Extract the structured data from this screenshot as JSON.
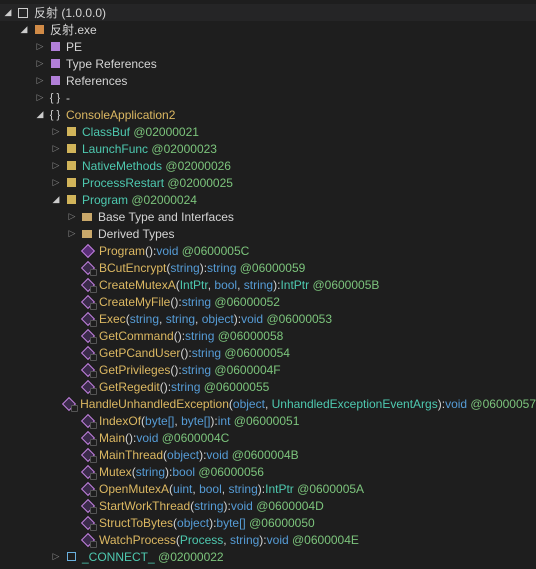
{
  "tab": {
    "title": "反射 (1.0.0.0)"
  },
  "root": {
    "name": "反射.exe"
  },
  "sections": [
    {
      "label": "PE"
    },
    {
      "label": "Type References"
    },
    {
      "label": "References"
    },
    {
      "label": "-"
    }
  ],
  "namespace": "ConsoleApplication2",
  "classes": [
    {
      "name": "ClassBuf",
      "token": "@02000021"
    },
    {
      "name": "LaunchFunc",
      "token": "@02000023"
    },
    {
      "name": "NativeMethods",
      "token": "@02000026"
    },
    {
      "name": "ProcessRestart",
      "token": "@02000025"
    }
  ],
  "program": {
    "name": "Program",
    "token": "@02000024"
  },
  "folders": [
    {
      "label": "Base Type and Interfaces"
    },
    {
      "label": "Derived Types"
    }
  ],
  "methods": [
    {
      "name": "Program",
      "params": [],
      "ret": "void",
      "token": "@0600005C",
      "kind": "pub"
    },
    {
      "name": "BCutEncrypt",
      "params": [
        "string"
      ],
      "ret": "string",
      "token": "@06000059",
      "kind": "stat"
    },
    {
      "name": "CreateMutexA",
      "params": [
        "IntPtr",
        "bool",
        "string"
      ],
      "ret": "IntPtr",
      "token": "@0600005B",
      "kind": "stat"
    },
    {
      "name": "CreateMyFile",
      "params": [],
      "ret": "string",
      "token": "@06000052",
      "kind": "stat"
    },
    {
      "name": "Exec",
      "params": [
        "string",
        "string",
        "object"
      ],
      "ret": "void",
      "token": "@06000053",
      "kind": "stat"
    },
    {
      "name": "GetCommand",
      "params": [],
      "ret": "string",
      "token": "@06000058",
      "kind": "stat"
    },
    {
      "name": "GetPCandUser",
      "params": [],
      "ret": "string",
      "token": "@06000054",
      "kind": "stat"
    },
    {
      "name": "GetPrivileges",
      "params": [],
      "ret": "string",
      "token": "@0600004F",
      "kind": "stat"
    },
    {
      "name": "GetRegedit",
      "params": [],
      "ret": "string",
      "token": "@06000055",
      "kind": "stat"
    },
    {
      "name": "HandleUnhandledException",
      "params": [
        "object",
        "UnhandledExceptionEventArgs"
      ],
      "ret": "void",
      "token": "@06000057",
      "kind": "stat"
    },
    {
      "name": "IndexOf",
      "params": [
        "byte[]",
        "byte[]"
      ],
      "ret": "int",
      "token": "@06000051",
      "kind": "stat"
    },
    {
      "name": "Main",
      "params": [],
      "ret": "void",
      "token": "@0600004C",
      "kind": "stat"
    },
    {
      "name": "MainThread",
      "params": [
        "object"
      ],
      "ret": "void",
      "token": "@0600004B",
      "kind": "stat"
    },
    {
      "name": "Mutex",
      "params": [
        "string"
      ],
      "ret": "bool",
      "token": "@06000056",
      "kind": "stat"
    },
    {
      "name": "OpenMutexA",
      "params": [
        "uint",
        "bool",
        "string"
      ],
      "ret": "IntPtr",
      "token": "@0600005A",
      "kind": "stat"
    },
    {
      "name": "StartWorkThread",
      "params": [
        "string"
      ],
      "ret": "void",
      "token": "@0600004D",
      "kind": "stat"
    },
    {
      "name": "StructToBytes",
      "params": [
        "object"
      ],
      "ret": "byte[]",
      "token": "@06000050",
      "kind": "stat"
    },
    {
      "name": "WatchProcess",
      "params": [
        "Process",
        "string"
      ],
      "ret": "void",
      "token": "@0600004E",
      "kind": "stat"
    }
  ],
  "extra": {
    "name": "_CONNECT_",
    "token": "@02000022"
  },
  "kw": {
    "void": "void",
    "string": "string",
    "bool": "bool",
    "uint": "uint",
    "int": "int",
    "object": "object",
    "byte[]": "byte[]"
  }
}
